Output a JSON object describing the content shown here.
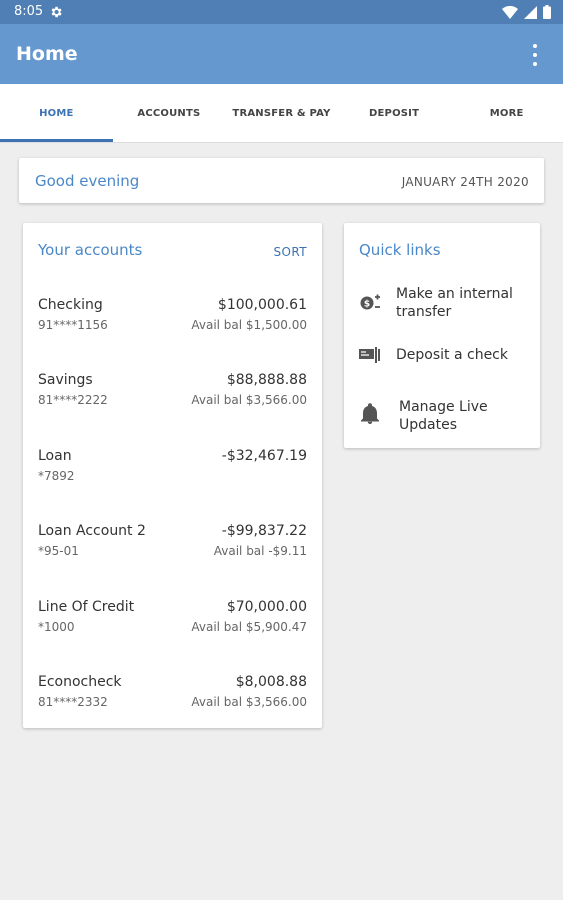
{
  "status_bar": {
    "time": "8:05"
  },
  "app_bar": {
    "title": "Home"
  },
  "tabs": [
    {
      "label": "HOME",
      "active": true
    },
    {
      "label": "ACCOUNTS",
      "active": false
    },
    {
      "label": "TRANSFER & PAY",
      "active": false
    },
    {
      "label": "DEPOSIT",
      "active": false
    },
    {
      "label": "MORE",
      "active": false
    }
  ],
  "greeting": {
    "text": "Good evening",
    "date": "JANUARY 24TH 2020"
  },
  "accounts": {
    "title": "Your accounts",
    "sort_label": "SORT",
    "items": [
      {
        "name": "Checking",
        "number": "91****1156",
        "amount": "$100,000.61",
        "avail": "Avail bal $1,500.00"
      },
      {
        "name": "Savings",
        "number": "81****2222",
        "amount": "$88,888.88",
        "avail": "Avail bal $3,566.00"
      },
      {
        "name": "Loan",
        "number": "*7892",
        "amount": "-$32,467.19",
        "avail": ""
      },
      {
        "name": "Loan Account 2",
        "number": "*95-01",
        "amount": "-$99,837.22",
        "avail": "Avail bal -$9.11"
      },
      {
        "name": "Line Of Credit",
        "number": "*1000",
        "amount": "$70,000.00",
        "avail": "Avail bal $5,900.47"
      },
      {
        "name": "Econocheck",
        "number": "81****2332",
        "amount": "$8,008.88",
        "avail": "Avail bal $3,566.00"
      }
    ]
  },
  "quick_links": {
    "title": "Quick links",
    "items": [
      {
        "line1": "Make an internal",
        "line2": "transfer",
        "icon": "transfer-money-icon"
      },
      {
        "line1": "Deposit a check",
        "line2": "",
        "icon": "check-deposit-icon"
      },
      {
        "line1": "Manage Live",
        "line2": "Updates",
        "icon": "bell-icon"
      }
    ]
  },
  "colors": {
    "status_bar": "#4f7fb4",
    "app_bar": "#6598cf",
    "accent": "#3d73b2",
    "heading": "#4a87c8",
    "background": "#eeeeee"
  }
}
